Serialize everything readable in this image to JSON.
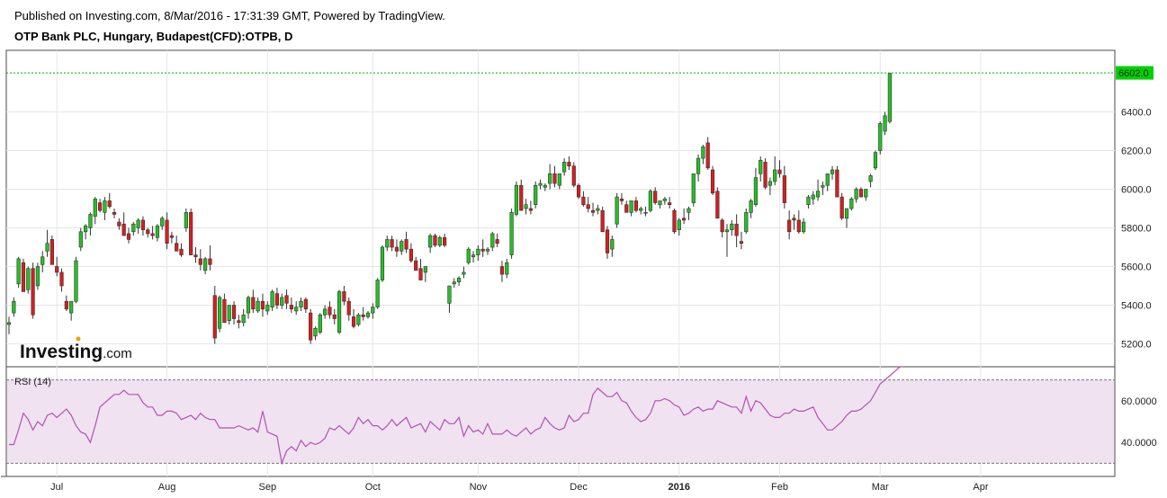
{
  "header": {
    "published": "Published on Investing.com, 8/Mar/2016 - 17:31:39 GMT, Powered by TradingView.",
    "symbol": "OTP Bank PLC, Hungary, Budapest(CFD):OTPB, D"
  },
  "logo": {
    "brand": "Investing",
    "suffix": ".com"
  },
  "colors": {
    "up": "#22c322",
    "down": "#d81e1e",
    "rsi": "#b153b1",
    "rsi_band": "#f0e2f0",
    "last_price_bg": "#00d100"
  },
  "chart_data": [
    {
      "type": "candlestick",
      "title": "OTP Bank PLC, Hungary, Budapest(CFD):OTPB, D",
      "y_range": [
        5100,
        6700
      ],
      "y_ticks": [
        "5200.0",
        "5400.0",
        "5600.0",
        "5800.0",
        "6000.0",
        "6200.0",
        "6400.0"
      ],
      "last_price": "6602.0",
      "last_value": 6602,
      "x_labels": [
        {
          "label": "Jul",
          "index": 10,
          "bold": false
        },
        {
          "label": "Aug",
          "index": 33,
          "bold": false
        },
        {
          "label": "Sep",
          "index": 54,
          "bold": false
        },
        {
          "label": "Oct",
          "index": 76,
          "bold": false
        },
        {
          "label": "Nov",
          "index": 98,
          "bold": false
        },
        {
          "label": "Dec",
          "index": 119,
          "bold": false
        },
        {
          "label": "2016",
          "index": 140,
          "bold": true
        },
        {
          "label": "Feb",
          "index": 161,
          "bold": false
        },
        {
          "label": "Mar",
          "index": 182,
          "bold": false
        },
        {
          "label": "Apr",
          "index": 203,
          "bold": false
        }
      ],
      "ohlc": [
        [
          5300,
          5340,
          5250,
          5310
        ],
        [
          5360,
          5440,
          5340,
          5420
        ],
        [
          5510,
          5650,
          5490,
          5640
        ],
        [
          5620,
          5640,
          5520,
          5470
        ],
        [
          5480,
          5600,
          5460,
          5590
        ],
        [
          5590,
          5620,
          5330,
          5350
        ],
        [
          5500,
          5620,
          5480,
          5600
        ],
        [
          5610,
          5680,
          5570,
          5650
        ],
        [
          5680,
          5790,
          5650,
          5720
        ],
        [
          5740,
          5760,
          5700,
          5610
        ],
        [
          5600,
          5650,
          5550,
          5570
        ],
        [
          5570,
          5590,
          5470,
          5500
        ],
        [
          5420,
          5450,
          5370,
          5380
        ],
        [
          5360,
          5420,
          5320,
          5420
        ],
        [
          5420,
          5650,
          5410,
          5630
        ],
        [
          5700,
          5800,
          5680,
          5780
        ],
        [
          5780,
          5820,
          5740,
          5810
        ],
        [
          5800,
          5880,
          5760,
          5870
        ],
        [
          5860,
          5960,
          5820,
          5950
        ],
        [
          5930,
          5950,
          5880,
          5890
        ],
        [
          5880,
          5960,
          5840,
          5940
        ],
        [
          5940,
          5980,
          5900,
          5910
        ],
        [
          5880,
          5900,
          5850,
          5870
        ],
        [
          5830,
          5850,
          5790,
          5810
        ],
        [
          5820,
          5880,
          5770,
          5760
        ],
        [
          5770,
          5800,
          5720,
          5740
        ],
        [
          5780,
          5830,
          5760,
          5820
        ],
        [
          5800,
          5850,
          5770,
          5840
        ],
        [
          5840,
          5860,
          5760,
          5790
        ],
        [
          5790,
          5800,
          5750,
          5770
        ],
        [
          5770,
          5810,
          5740,
          5760
        ],
        [
          5750,
          5820,
          5730,
          5810
        ],
        [
          5810,
          5860,
          5790,
          5850
        ],
        [
          5840,
          5880,
          5690,
          5720
        ],
        [
          5760,
          5780,
          5720,
          5750
        ],
        [
          5720,
          5760,
          5690,
          5680
        ],
        [
          5690,
          5720,
          5650,
          5660
        ],
        [
          5800,
          5900,
          5780,
          5880
        ],
        [
          5880,
          5900,
          5680,
          5660
        ],
        [
          5660,
          5700,
          5620,
          5650
        ],
        [
          5640,
          5690,
          5580,
          5610
        ],
        [
          5580,
          5650,
          5560,
          5640
        ],
        [
          5640,
          5710,
          5580,
          5610
        ],
        [
          5450,
          5500,
          5200,
          5230
        ],
        [
          5280,
          5450,
          5260,
          5440
        ],
        [
          5430,
          5460,
          5350,
          5310
        ],
        [
          5320,
          5400,
          5300,
          5400
        ],
        [
          5400,
          5420,
          5300,
          5330
        ],
        [
          5320,
          5350,
          5280,
          5310
        ],
        [
          5310,
          5380,
          5290,
          5350
        ],
        [
          5360,
          5450,
          5330,
          5440
        ],
        [
          5440,
          5480,
          5360,
          5380
        ],
        [
          5370,
          5440,
          5360,
          5420
        ],
        [
          5420,
          5460,
          5340,
          5380
        ],
        [
          5370,
          5420,
          5350,
          5400
        ],
        [
          5390,
          5480,
          5370,
          5470
        ],
        [
          5460,
          5490,
          5380,
          5400
        ],
        [
          5400,
          5460,
          5380,
          5440
        ],
        [
          5450,
          5480,
          5380,
          5410
        ],
        [
          5400,
          5440,
          5360,
          5380
        ],
        [
          5370,
          5420,
          5350,
          5390
        ],
        [
          5390,
          5440,
          5370,
          5420
        ],
        [
          5430,
          5440,
          5360,
          5380
        ],
        [
          5360,
          5380,
          5200,
          5220
        ],
        [
          5240,
          5290,
          5220,
          5280
        ],
        [
          5260,
          5360,
          5250,
          5350
        ],
        [
          5350,
          5400,
          5330,
          5380
        ],
        [
          5390,
          5420,
          5330,
          5350
        ],
        [
          5350,
          5380,
          5300,
          5330
        ],
        [
          5260,
          5480,
          5250,
          5470
        ],
        [
          5470,
          5500,
          5400,
          5420
        ],
        [
          5420,
          5440,
          5320,
          5350
        ],
        [
          5340,
          5380,
          5280,
          5290
        ],
        [
          5300,
          5360,
          5290,
          5350
        ],
        [
          5350,
          5390,
          5320,
          5340
        ],
        [
          5340,
          5370,
          5330,
          5360
        ],
        [
          5360,
          5410,
          5330,
          5390
        ],
        [
          5390,
          5540,
          5380,
          5530
        ],
        [
          5530,
          5710,
          5520,
          5700
        ],
        [
          5700,
          5760,
          5680,
          5740
        ],
        [
          5740,
          5760,
          5680,
          5700
        ],
        [
          5700,
          5740,
          5650,
          5680
        ],
        [
          5680,
          5740,
          5660,
          5730
        ],
        [
          5740,
          5780,
          5670,
          5690
        ],
        [
          5690,
          5720,
          5620,
          5630
        ],
        [
          5630,
          5650,
          5580,
          5580
        ],
        [
          5590,
          5640,
          5530,
          5530
        ],
        [
          5570,
          5600,
          5520,
          5600
        ],
        [
          5700,
          5770,
          5670,
          5760
        ],
        [
          5760,
          5770,
          5700,
          5710
        ],
        [
          5710,
          5760,
          5700,
          5750
        ],
        [
          5750,
          5770,
          5700,
          5710
        ],
        [
          5410,
          5460,
          5360,
          5500
        ],
        [
          5510,
          5540,
          5490,
          5520
        ],
        [
          5520,
          5550,
          5500,
          5540
        ],
        [
          5560,
          5600,
          5540,
          5570
        ],
        [
          5620,
          5700,
          5610,
          5690
        ],
        [
          5650,
          5680,
          5620,
          5660
        ],
        [
          5660,
          5710,
          5630,
          5690
        ],
        [
          5690,
          5740,
          5650,
          5680
        ],
        [
          5680,
          5700,
          5660,
          5690
        ],
        [
          5700,
          5780,
          5680,
          5770
        ],
        [
          5740,
          5770,
          5700,
          5720
        ],
        [
          5600,
          5630,
          5520,
          5560
        ],
        [
          5560,
          5640,
          5540,
          5620
        ],
        [
          5660,
          5900,
          5640,
          5880
        ],
        [
          5870,
          6040,
          5860,
          6020
        ],
        [
          6020,
          6050,
          5910,
          5890
        ],
        [
          5900,
          5950,
          5870,
          5920
        ],
        [
          5900,
          5940,
          5870,
          5890
        ],
        [
          5920,
          6040,
          5900,
          6020
        ],
        [
          6020,
          6050,
          6000,
          6030
        ],
        [
          6010,
          6030,
          5990,
          6020
        ],
        [
          6030,
          6130,
          6000,
          6080
        ],
        [
          6080,
          6120,
          6010,
          6030
        ],
        [
          6020,
          6080,
          6000,
          6080
        ],
        [
          6090,
          6160,
          6070,
          6140
        ],
        [
          6140,
          6170,
          6100,
          6120
        ],
        [
          6120,
          6140,
          6010,
          6020
        ],
        [
          6020,
          6030,
          5950,
          5960
        ],
        [
          5960,
          5990,
          5910,
          5920
        ],
        [
          5920,
          5960,
          5880,
          5900
        ],
        [
          5890,
          5930,
          5860,
          5880
        ],
        [
          5890,
          5920,
          5870,
          5900
        ],
        [
          5890,
          5910,
          5780,
          5780
        ],
        [
          5790,
          5810,
          5640,
          5670
        ],
        [
          5690,
          5760,
          5650,
          5740
        ],
        [
          5820,
          5980,
          5800,
          5960
        ],
        [
          5950,
          5980,
          5920,
          5940
        ],
        [
          5920,
          5940,
          5880,
          5880
        ],
        [
          5880,
          5940,
          5860,
          5940
        ],
        [
          5940,
          5960,
          5880,
          5890
        ],
        [
          5890,
          5910,
          5870,
          5900
        ],
        [
          5880,
          5910,
          5860,
          5880
        ],
        [
          5890,
          6000,
          5880,
          5990
        ],
        [
          5990,
          6010,
          5920,
          5930
        ],
        [
          5920,
          5940,
          5900,
          5940
        ],
        [
          5940,
          5960,
          5920,
          5950
        ],
        [
          5930,
          5960,
          5900,
          5920
        ],
        [
          5890,
          5900,
          5770,
          5780
        ],
        [
          5790,
          5850,
          5760,
          5840
        ],
        [
          5850,
          5900,
          5820,
          5840
        ],
        [
          5880,
          5910,
          5840,
          5900
        ],
        [
          5930,
          6080,
          5910,
          6080
        ],
        [
          6080,
          6180,
          6040,
          6160
        ],
        [
          6160,
          6230,
          6130,
          6220
        ],
        [
          6240,
          6270,
          6100,
          6110
        ],
        [
          6100,
          6120,
          5970,
          5980
        ],
        [
          5990,
          6010,
          5850,
          5850
        ],
        [
          5840,
          5850,
          5750,
          5780
        ],
        [
          5780,
          5820,
          5650,
          5790
        ],
        [
          5790,
          5840,
          5760,
          5820
        ],
        [
          5820,
          5870,
          5700,
          5760
        ],
        [
          5730,
          5780,
          5690,
          5720
        ],
        [
          5780,
          5900,
          5770,
          5880
        ],
        [
          5880,
          5950,
          5850,
          5940
        ],
        [
          5920,
          6110,
          5910,
          6060
        ],
        [
          6080,
          6170,
          6040,
          6150
        ],
        [
          6140,
          6160,
          6000,
          6010
        ],
        [
          6020,
          6060,
          5970,
          6040
        ],
        [
          6040,
          6170,
          6020,
          6100
        ],
        [
          6100,
          6150,
          6060,
          6080
        ],
        [
          6070,
          6120,
          5900,
          5930
        ],
        [
          5840,
          5890,
          5740,
          5780
        ],
        [
          5850,
          5870,
          5790,
          5840
        ],
        [
          5840,
          5890,
          5770,
          5780
        ],
        [
          5780,
          5850,
          5770,
          5830
        ],
        [
          5920,
          5970,
          5900,
          5960
        ],
        [
          5950,
          5990,
          5920,
          5970
        ],
        [
          5960,
          6050,
          5940,
          5990
        ],
        [
          6010,
          6040,
          5970,
          6020
        ],
        [
          6020,
          6060,
          5990,
          6080
        ],
        [
          6080,
          6120,
          6050,
          6100
        ],
        [
          6100,
          6120,
          5960,
          5960
        ],
        [
          5960,
          5980,
          5840,
          5850
        ],
        [
          5850,
          5900,
          5800,
          5900
        ],
        [
          5900,
          5960,
          5890,
          5950
        ],
        [
          5950,
          6010,
          5930,
          6000
        ],
        [
          6000,
          6010,
          5960,
          5960
        ],
        [
          5960,
          5970,
          5940,
          6000
        ],
        [
          6040,
          6080,
          6010,
          6070
        ],
        [
          6110,
          6200,
          6100,
          6190
        ],
        [
          6200,
          6350,
          6180,
          6340
        ],
        [
          6300,
          6400,
          6280,
          6380
        ],
        [
          6350,
          6460,
          6340,
          6600
        ]
      ]
    },
    {
      "type": "line",
      "title": "RSI (14)",
      "y_range": [
        25,
        75
      ],
      "y_ticks": [
        "40.0000",
        "60.0000"
      ],
      "band": [
        30,
        70
      ],
      "values": [
        39,
        39,
        46,
        54,
        51,
        46,
        50,
        48,
        53,
        54,
        52,
        54,
        56,
        53,
        48,
        45,
        44,
        40,
        48,
        57,
        59,
        61,
        63,
        63,
        65,
        63,
        63,
        63,
        59,
        57,
        57,
        53,
        53,
        55,
        55,
        54,
        51,
        52,
        53,
        51,
        54,
        52,
        51,
        51,
        47,
        47,
        47,
        47,
        48,
        47,
        46,
        47,
        45,
        55,
        45,
        44,
        43,
        30,
        36,
        38,
        36,
        41,
        38,
        40,
        39,
        40,
        42,
        47,
        46,
        48,
        46,
        44,
        47,
        52,
        49,
        51,
        48,
        48,
        46,
        48,
        51,
        48,
        50,
        52,
        47,
        48,
        49,
        45,
        50,
        48,
        46,
        51,
        49,
        49,
        52,
        43,
        48,
        45,
        46,
        44,
        49,
        44,
        44,
        44,
        46,
        44,
        43,
        45,
        47,
        44,
        46,
        47,
        52,
        49,
        47,
        46,
        47,
        53,
        50,
        51,
        54,
        54,
        63,
        66,
        64,
        62,
        62,
        64,
        60,
        59,
        55,
        52,
        50,
        51,
        54,
        60,
        60,
        61,
        60,
        58,
        57,
        53,
        54,
        56,
        57,
        55,
        56,
        56,
        60,
        59,
        58,
        57,
        57,
        54,
        62,
        55,
        60,
        59,
        56,
        53,
        52,
        52,
        54,
        54,
        56,
        55,
        55,
        56,
        57,
        52,
        49,
        46,
        46,
        48,
        50,
        53,
        55,
        55,
        56,
        58,
        60,
        64,
        68,
        70,
        72,
        74,
        76,
        77,
        78,
        80
      ]
    }
  ]
}
